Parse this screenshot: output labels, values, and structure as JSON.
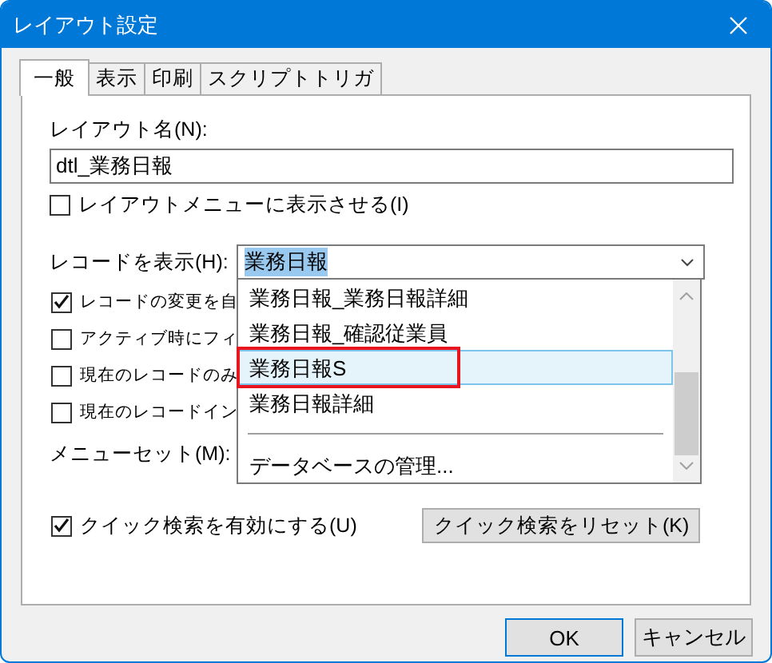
{
  "window": {
    "title": "レイアウト設定"
  },
  "tabs": [
    {
      "label": "一般",
      "selected": true
    },
    {
      "label": "表示",
      "selected": false
    },
    {
      "label": "印刷",
      "selected": false
    },
    {
      "label": "スクリプトトリガ",
      "selected": false
    }
  ],
  "layout_name": {
    "label": "レイアウト名(N):",
    "value": "dtl_業務日報"
  },
  "show_in_menu": {
    "label": "レイアウトメニューに表示させる(I)",
    "checked": false
  },
  "show_records": {
    "label": "レコードを表示(H):",
    "value": "業務日報",
    "expanded": true,
    "options": [
      {
        "label": "業務日報_業務日報詳細",
        "selected": false,
        "highlighted": false
      },
      {
        "label": "業務日報_確認従業員",
        "selected": false,
        "highlighted": false
      },
      {
        "label": "業務日報S",
        "selected": true,
        "highlighted": true
      },
      {
        "label": "業務日報詳細",
        "selected": false,
        "highlighted": false
      }
    ],
    "action": "データベースの管理..."
  },
  "options": [
    {
      "label": "レコードの変更を自",
      "checked": true
    },
    {
      "label": "アクティブ時にフィ",
      "checked": false
    },
    {
      "label": "現在のレコードのみ",
      "checked": false
    },
    {
      "label": "現在のレコードイン",
      "checked": false
    }
  ],
  "menu_set": {
    "label": "メニューセット(M):"
  },
  "quick_find": {
    "label": "クイック検索を有効にする(U)",
    "checked": true
  },
  "reset_button": {
    "label": "クイック検索をリセット(K)"
  },
  "buttons": [
    {
      "label": "OK",
      "default": true
    },
    {
      "label": "キャンセル",
      "default": false
    }
  ]
}
